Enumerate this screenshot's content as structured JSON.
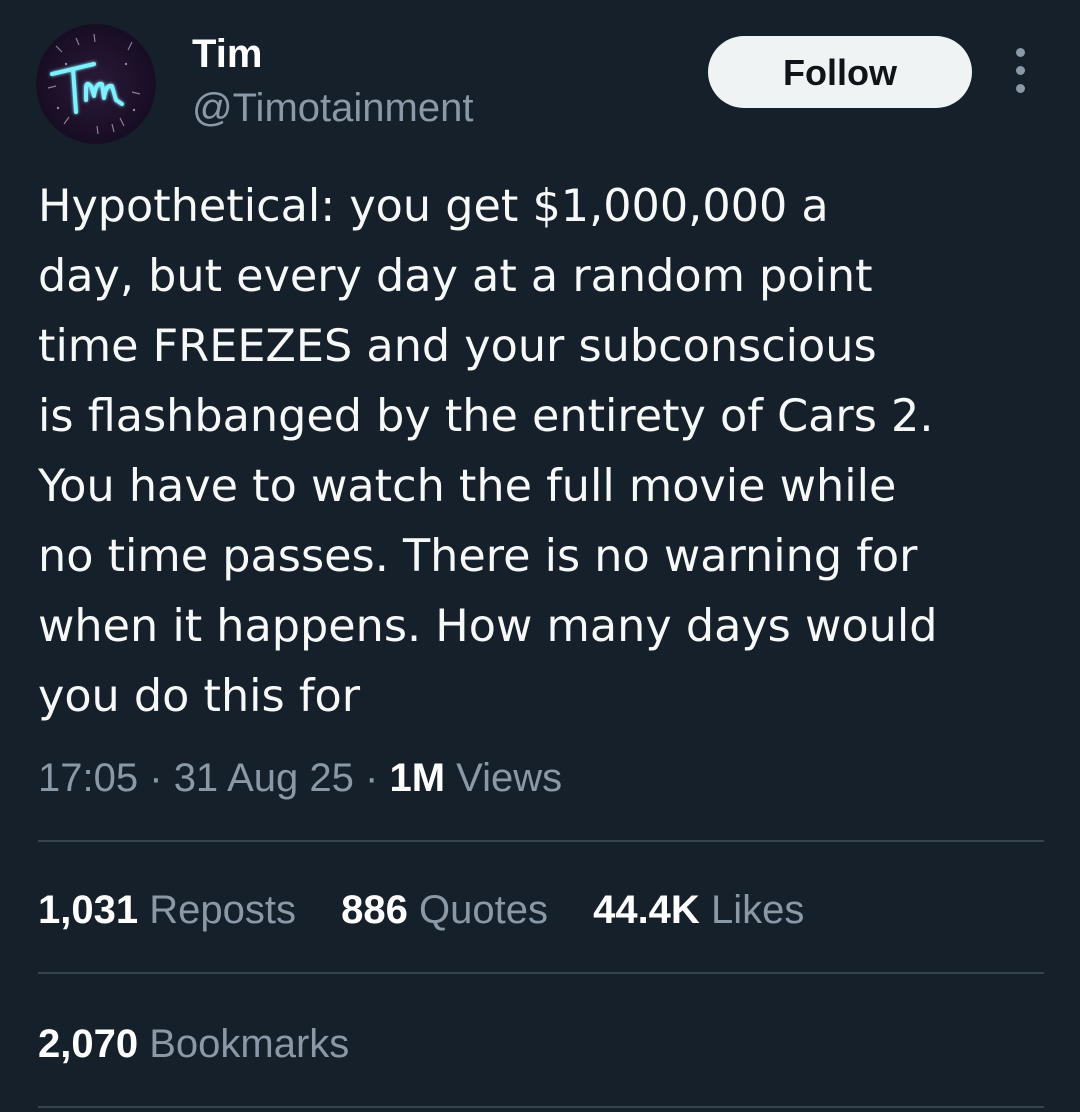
{
  "author": {
    "display_name": "Tim",
    "handle": "@Timotainment",
    "avatar_text": "Tm"
  },
  "header": {
    "follow_label": "Follow"
  },
  "tweet": {
    "text": "Hypothetical: you get $1,000,000 a\nday, but every day at a random point\ntime FREEZES and your subconscious\nis flashbanged by the entirety of Cars 2.\nYou have to watch the full movie while\nno time passes. There is no warning for\nwhen it happens. How many days would\nyou do this for",
    "time": "17:05",
    "date": "31 Aug 25",
    "separator": "·",
    "views_count": "1M",
    "views_label": "Views"
  },
  "stats": {
    "reposts": {
      "count": "1,031",
      "label": "Reposts"
    },
    "quotes": {
      "count": "886",
      "label": "Quotes"
    },
    "likes": {
      "count": "44.4K",
      "label": "Likes"
    },
    "bookmarks": {
      "count": "2,070",
      "label": "Bookmarks"
    }
  },
  "colors": {
    "background": "#15202b",
    "secondary_text": "#8b98a5",
    "divider": "#38444d",
    "follow_bg": "#eff3f4",
    "avatar_glow": "#7ff0ff"
  }
}
